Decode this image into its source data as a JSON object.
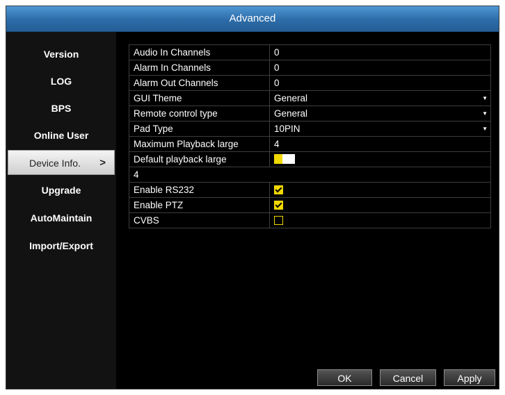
{
  "window": {
    "title": "Advanced"
  },
  "sidebar": {
    "items": [
      {
        "label": "Version",
        "active": false
      },
      {
        "label": "LOG",
        "active": false
      },
      {
        "label": "BPS",
        "active": false
      },
      {
        "label": "Online User",
        "active": false
      },
      {
        "label": "Device Info.",
        "active": true,
        "chevron": ">"
      },
      {
        "label": "Upgrade",
        "active": false
      },
      {
        "label": "AutoMaintain",
        "active": false
      },
      {
        "label": "Import/Export",
        "active": false
      }
    ]
  },
  "settings": {
    "audio_in_channels": {
      "label": "Audio In Channels",
      "value": "0"
    },
    "alarm_in_channels": {
      "label": "Alarm In Channels",
      "value": "0"
    },
    "alarm_out_channels": {
      "label": "Alarm Out Channels",
      "value": "0"
    },
    "gui_theme": {
      "label": "GUI Theme",
      "value": "General"
    },
    "remote_control_type": {
      "label": "Remote control type",
      "value": "General"
    },
    "pad_type": {
      "label": "Pad Type",
      "value": "10PIN"
    },
    "max_playback_large": {
      "label": "Maximum Playback large",
      "value": "4"
    },
    "default_playback_large": {
      "label": "Default playback large",
      "slider_level": 0.4,
      "value": "4"
    },
    "enable_rs232": {
      "label": "Enable RS232",
      "checked": true
    },
    "enable_ptz": {
      "label": "Enable PTZ",
      "checked": true
    },
    "cvbs": {
      "label": "CVBS",
      "checked": false
    }
  },
  "buttons": {
    "ok": "OK",
    "cancel": "Cancel",
    "apply": "Apply"
  },
  "colors": {
    "titlebar": "#3a82c4",
    "accent": "#f0d800",
    "background": "#000000"
  },
  "icons": {
    "dropdown": "triangle-down-icon",
    "nav_chevron": "chevron-right-icon",
    "checkbox": "check-icon"
  }
}
